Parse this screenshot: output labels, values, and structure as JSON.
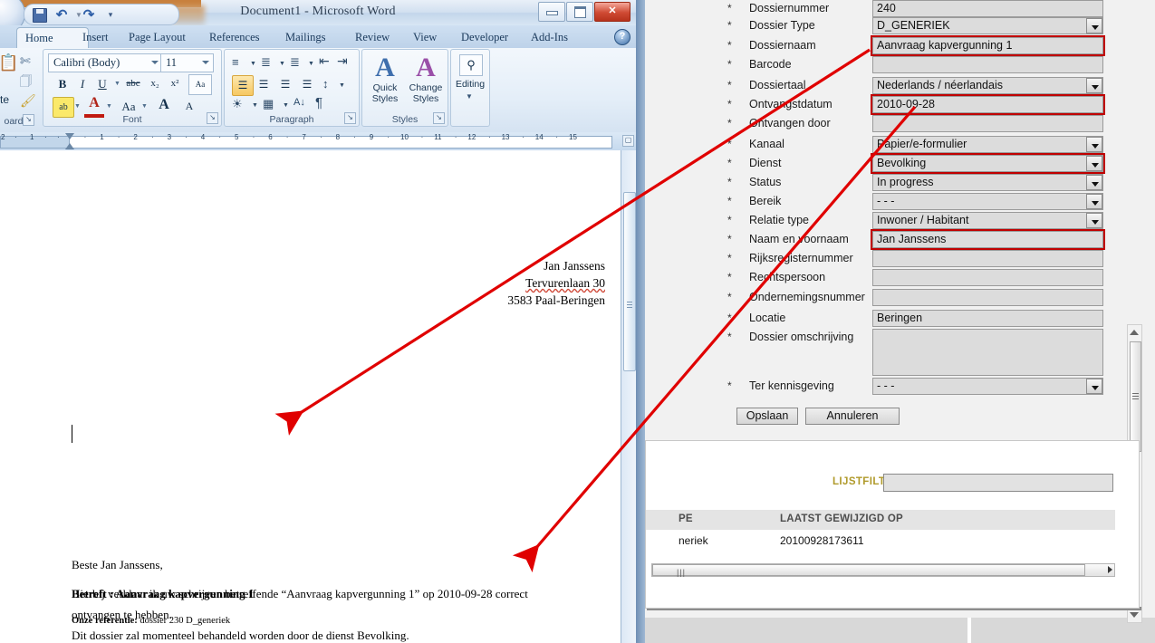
{
  "word": {
    "title": "Document1 - Microsoft Word",
    "quick_access": {
      "save": "save-icon",
      "undo": "undo-icon",
      "redo": "redo-icon",
      "customize": "customize-icon"
    },
    "window_buttons": {
      "minimize": "minimize",
      "maximize": "maximize",
      "close": "✕"
    },
    "tabs": [
      {
        "label": "Home",
        "active": true
      },
      {
        "label": "Insert",
        "active": false
      },
      {
        "label": "Page Layout",
        "active": false
      },
      {
        "label": "References",
        "active": false
      },
      {
        "label": "Mailings",
        "active": false
      },
      {
        "label": "Review",
        "active": false
      },
      {
        "label": "View",
        "active": false
      },
      {
        "label": "Developer",
        "active": false
      },
      {
        "label": "Add-Ins",
        "active": false
      }
    ],
    "help_label": "?",
    "groups": {
      "clipboard": {
        "label": "oard",
        "paste_label": "te"
      },
      "font": {
        "label": "Font",
        "font_name": "Calibri (Body)",
        "font_size": "11",
        "bold": "B",
        "italic": "I",
        "underline": "U",
        "strike": "abc",
        "subscript": "x₂",
        "superscript": "x²",
        "clear_format": "Aa",
        "highlight": "ab",
        "font_color": "A",
        "change_case": "Aa",
        "grow_font": "A",
        "shrink_font": "A"
      },
      "paragraph": {
        "label": "Paragraph",
        "pilcrow": "¶",
        "sort": "A↓"
      },
      "styles": {
        "label": "Styles",
        "quick_styles": "Quick Styles",
        "change_styles": "Change Styles"
      },
      "editing": {
        "label": "Editing"
      }
    },
    "ruler": {
      "left_marks": [
        "2",
        "1"
      ],
      "marks": [
        "1",
        "2",
        "3",
        "4",
        "5",
        "6",
        "7",
        "8",
        "9",
        "10",
        "11",
        "12",
        "13",
        "14",
        "15"
      ]
    },
    "document": {
      "address": [
        "Jan Janssens",
        "Tervurenlaan 30",
        "3583 Paal-Beringen"
      ],
      "subject_prefix": "Betreft : ",
      "subject": "Aanvraag kapvergunning 1",
      "reference_label": "Onze referentie:",
      "reference_value": " dossier 230 D_generiek",
      "salutation": "Beste Jan Janssens,",
      "paragraph1_line1": "Hierbij verklaar ik  uw schrijven betreffende “Aanvraag kapvergunning 1” op 2010-09-28  correct",
      "paragraph1_line2": "ontvangen te hebben.",
      "paragraph2": "Dit dossier zal momenteel behandeld worden door de dienst Bevolking."
    }
  },
  "form": {
    "required_marker": "*",
    "fields": [
      {
        "label": "Dossiernummer",
        "value": "240",
        "type": "text",
        "highlight": false
      },
      {
        "label": "Dossier Type",
        "value": "D_GENERIEK",
        "type": "select",
        "highlight": false
      },
      {
        "label": "Dossiernaam",
        "value": "Aanvraag kapvergunning 1",
        "type": "text",
        "highlight": true
      },
      {
        "label": "Barcode",
        "value": "",
        "type": "text",
        "highlight": false
      },
      {
        "label": "Dossiertaal",
        "value": "Nederlands / néerlandais",
        "type": "select",
        "highlight": false
      },
      {
        "label": "Ontvangstdatum",
        "value": "2010-09-28",
        "type": "text",
        "highlight": true
      },
      {
        "label": "Ontvangen door",
        "value": "",
        "type": "text",
        "highlight": false
      },
      {
        "label": "Kanaal",
        "value": "Papier/e-formulier",
        "type": "select",
        "highlight": false
      },
      {
        "label": "Dienst",
        "value": "Bevolking",
        "type": "select",
        "highlight": true
      },
      {
        "label": "Status",
        "value": "In progress",
        "type": "select",
        "highlight": false
      },
      {
        "label": "Bereik",
        "value": "- - -",
        "type": "select",
        "highlight": false
      },
      {
        "label": "Relatie type",
        "value": "Inwoner / Habitant",
        "type": "select",
        "highlight": false
      },
      {
        "label": "Naam en voornaam",
        "value": "Jan Janssens",
        "type": "text",
        "highlight": true
      },
      {
        "label": "Rijksregisternummer",
        "value": "",
        "type": "text",
        "highlight": false
      },
      {
        "label": "Rechtspersoon",
        "value": "",
        "type": "text",
        "highlight": false
      },
      {
        "label": "Ondernemingsnummer",
        "value": "",
        "type": "text",
        "highlight": false
      },
      {
        "label": "Locatie",
        "value": "Beringen",
        "type": "text",
        "highlight": false
      },
      {
        "label": "Dossier omschrijving",
        "value": "",
        "type": "textarea",
        "highlight": false
      },
      {
        "label": "Ter kennisgeving",
        "value": "- - -",
        "type": "select",
        "highlight": false
      }
    ],
    "buttons": {
      "save": "Opslaan",
      "cancel": "Annuleren"
    }
  },
  "list": {
    "filter_label": "LIJSTFILTER",
    "filter_value": "",
    "columns": [
      "PE",
      "LAATST GEWIJZIGD OP"
    ],
    "rows": [
      {
        "type": "neriek",
        "modified": "20100928173611"
      }
    ]
  },
  "colors": {
    "highlight_red": "#c00000",
    "arrow_red": "#e00000",
    "filter_gold": "#b09a2b",
    "word_blue": "#bdd2e9"
  }
}
